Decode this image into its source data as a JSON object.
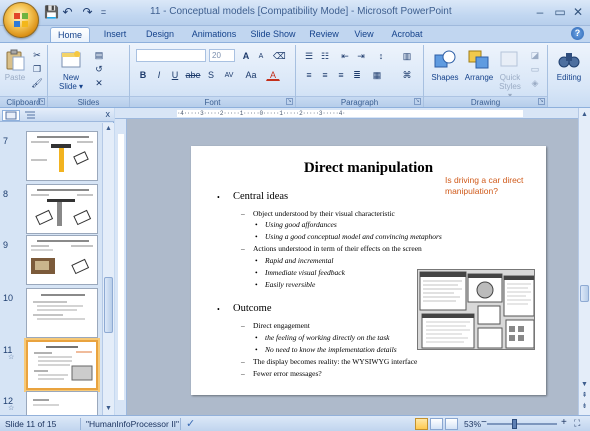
{
  "window": {
    "title": "11 - Conceptual models [Compatibility Mode] - Microsoft PowerPoint",
    "minimize": "–",
    "close": "✕",
    "restore": "▭"
  },
  "qat": {
    "save": "💾",
    "undo": "↶",
    "redo": "↷",
    "more": "="
  },
  "tabs": [
    "Home",
    "Insert",
    "Design",
    "Animations",
    "Slide Show",
    "Review",
    "View",
    "Acrobat"
  ],
  "active_tab": "Home",
  "ribbon": {
    "clipboard": {
      "label": "Clipboard",
      "paste": "Paste"
    },
    "slides": {
      "label": "Slides",
      "new_slide": "New Slide ▾",
      "new_slide_line1": "New",
      "new_slide_line2": "Slide ▾"
    },
    "font": {
      "label": "Font",
      "font_name": "",
      "font_size": "20",
      "bold": "B",
      "italic": "I",
      "underline": "U",
      "strike": "abe",
      "shadow": "S",
      "spacing": "AV",
      "case": "Aa",
      "color": "A",
      "grow": "A",
      "shrink": "A"
    },
    "paragraph": {
      "label": "Paragraph"
    },
    "drawing": {
      "label": "Drawing",
      "shapes": "Shapes",
      "arrange": "Arrange",
      "quick_styles": "Quick Styles",
      "quick_line1": "Quick",
      "quick_line2": "Styles ▾"
    },
    "editing": {
      "label": "Editing"
    }
  },
  "left_panel": {
    "close": "x",
    "thumbnails": [
      {
        "number": "7",
        "selected": false
      },
      {
        "number": "8",
        "selected": false
      },
      {
        "number": "9",
        "selected": false
      },
      {
        "number": "10",
        "selected": false
      },
      {
        "number": "11",
        "selected": true
      },
      {
        "number": "12",
        "selected": false
      }
    ]
  },
  "ruler": {
    "horizontal": "·4·····3·····2·····1·····0·····1·····2·····3·····4·"
  },
  "slide": {
    "title": "Direct manipulation",
    "callout": "Is driving a car direct manipulation?",
    "bullets": {
      "central_ideas": "Central ideas",
      "object_understood": "Object understood by their visual characteristic",
      "good_affordances": "Using good affordances",
      "good_conceptual_model": "Using a good conceptual model and convincing metaphors",
      "actions_understood": "Actions understood in term of their effects on the screen",
      "rapid": "Rapid and incremental",
      "immediate_feedback": "Immediate visual feedback",
      "reversible": "Easily reversible",
      "outcome": "Outcome",
      "direct_engagement": "Direct engagement",
      "feeling_of_working": "the feeling of working directly on the task",
      "no_need_impl": "No need to know the implementation details",
      "display_reality": "The display becomes reality: the WYSIWYG interface",
      "fewer_errors": "Fewer error messages?"
    }
  },
  "status": {
    "slide_info": "Slide 11 of 15",
    "theme": "\"HumanInfoProcessor II\"",
    "zoom": "53%",
    "zoom_minus": "−",
    "zoom_plus": "+"
  }
}
